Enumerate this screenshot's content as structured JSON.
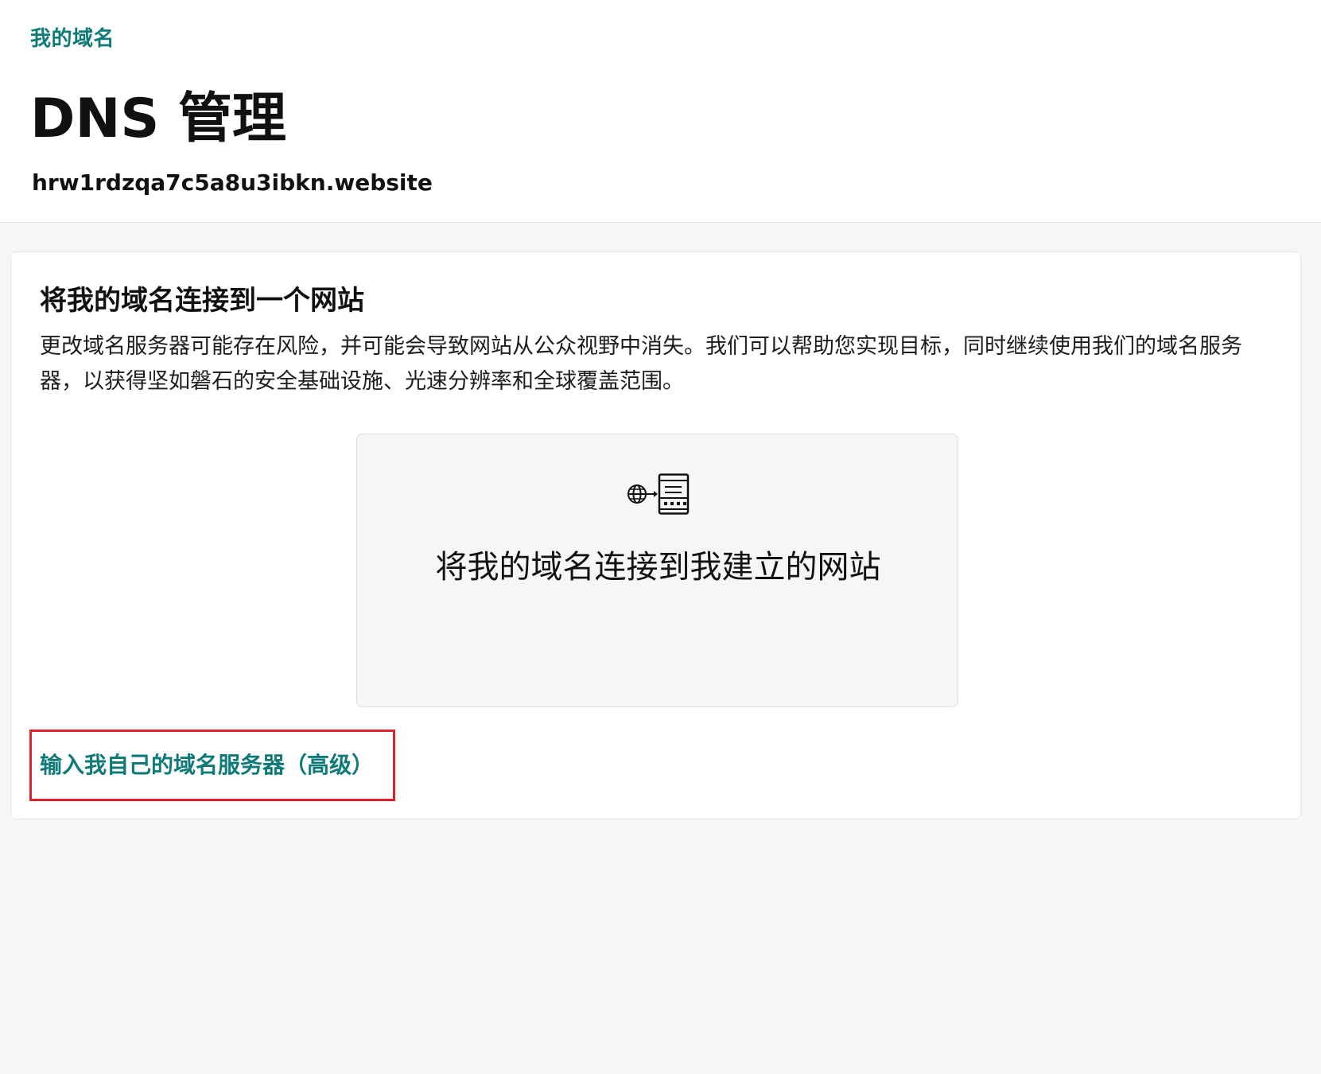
{
  "header": {
    "breadcrumb": "我的域名",
    "title": "DNS 管理",
    "domain": "hrw1rdzqa7c5a8u3ibkn.website"
  },
  "connect_section": {
    "title": "将我的域名连接到一个网站",
    "description": "更改域名服务器可能存在风险，并可能会导致网站从公众视野中消失。我们可以帮助您实现目标，同时继续使用我们的域名服务器，以获得坚如磐石的安全基础设施、光速分辨率和全球覆盖范围。",
    "option": {
      "icon": "globe-to-server-icon",
      "label": "将我的域名连接到我建立的网站"
    },
    "advanced_link": "输入我自己的域名服务器（高级）"
  },
  "colors": {
    "accent": "#0f7b78",
    "highlight_box": "#e0202b",
    "page_background": "#f5f6f8",
    "card_background": "#ffffff"
  }
}
